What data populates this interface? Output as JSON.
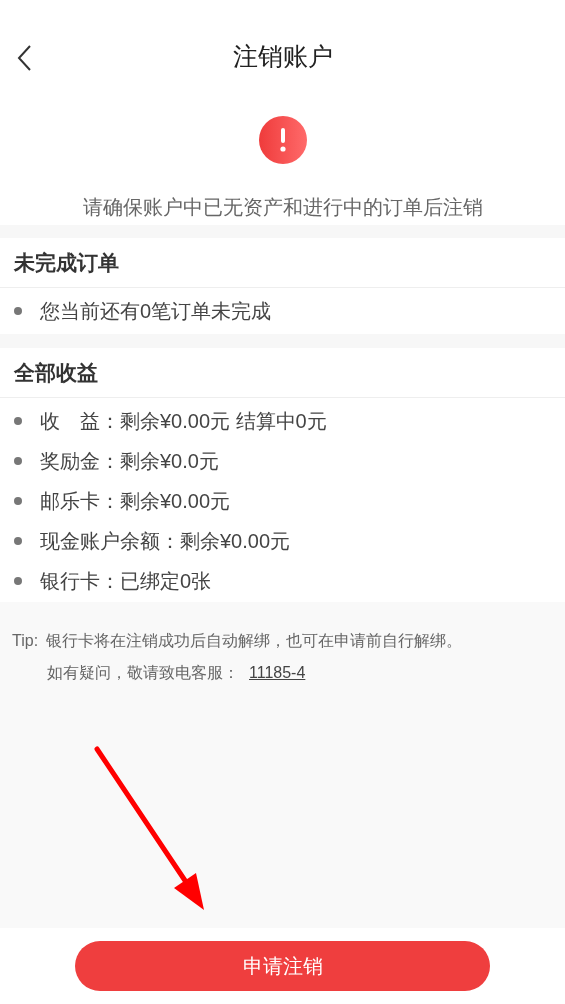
{
  "header": {
    "title": "注销账户"
  },
  "notice": "请确保账户中已无资产和进行中的订单后注销",
  "sections": [
    {
      "title": "未完成订单",
      "items": [
        "您当前还有0笔订单未完成"
      ]
    },
    {
      "title": "全部收益",
      "items": [
        "收　益：剩余¥0.00元 结算中0元",
        "奖励金：剩余¥0.0元",
        "邮乐卡：剩余¥0.00元",
        "现金账户余额：剩余¥0.00元",
        "银行卡：已绑定0张"
      ]
    }
  ],
  "tip": {
    "label": "Tip:",
    "line_1": "银行卡将在注销成功后自动解绑，也可在申请前自行解绑。",
    "line_2": "如有疑问，敬请致电客服：",
    "phone": "11185-4"
  },
  "submit_button": "申请注销"
}
